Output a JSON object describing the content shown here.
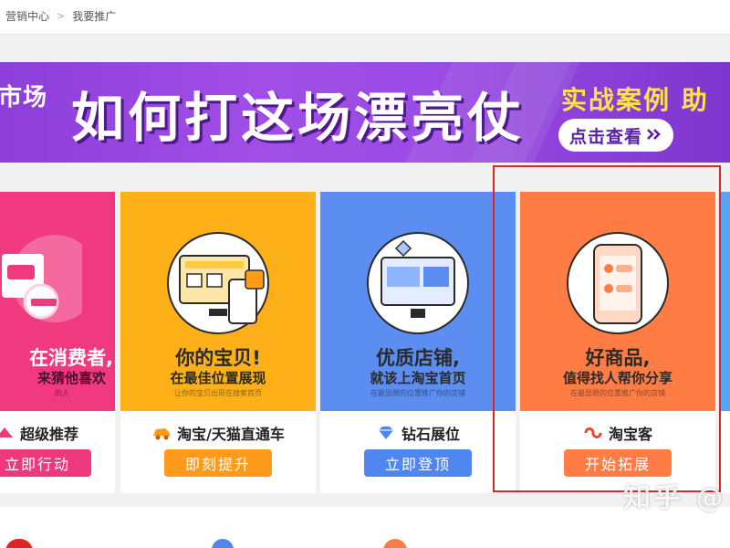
{
  "breadcrumb": {
    "root": "营销中心",
    "separator": ">",
    "current": "我要推广"
  },
  "banner": {
    "left_text": "市场",
    "headline": "如何打这场漂亮仗",
    "subline": "实战案例 助",
    "cta": "点击查看"
  },
  "cards": [
    {
      "line1": "在消费者,",
      "line2": "来猜他喜欢",
      "line3": "的人",
      "product": "超级推荐",
      "button": "立即行动",
      "icon": "megaphone-icon"
    },
    {
      "line1": "你的宝贝!",
      "line2": "在最佳位置展现",
      "line3": "让你的宝贝出现在搜索首页",
      "product": "淘宝/天猫直通车",
      "button": "即刻提升",
      "icon": "car-icon"
    },
    {
      "line1": "优质店铺,",
      "line2": "就该上淘宝首页",
      "line3": "在最显眼的位置推广你的店铺",
      "product": "钻石展位",
      "button": "立即登顶",
      "icon": "diamond-icon"
    },
    {
      "line1": "好商品,",
      "line2": "值得找人帮你分享",
      "line3": "在最显眼的位置推广你的店铺",
      "product": "淘宝客",
      "button": "开始拓展",
      "icon": "taobaoke-logo-icon"
    }
  ],
  "watermark": "知乎 @",
  "colors": {
    "pink": "#f0397e",
    "yellow": "#fdb018",
    "blue": "#5b8ef0",
    "orange": "#ff7c45",
    "highlight": "#e02424",
    "banner": "#9a4be3"
  }
}
